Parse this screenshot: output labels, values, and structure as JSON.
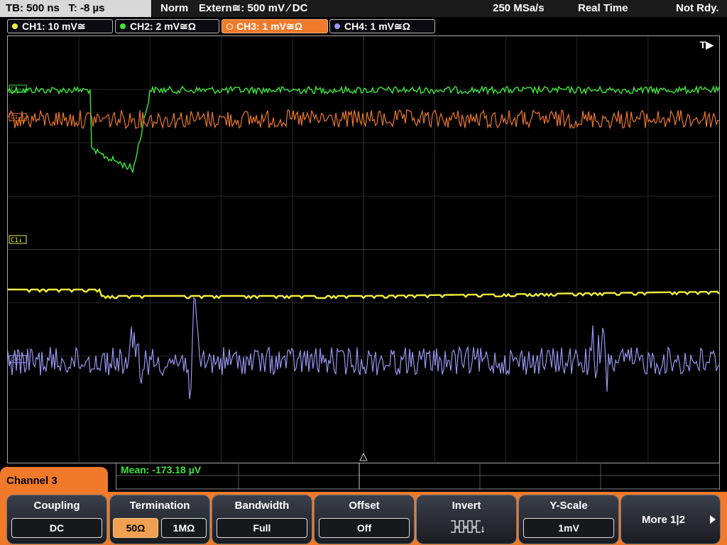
{
  "status": {
    "timebase": "TB: 500 ns",
    "trigger_time": "T: -8 µs",
    "mode": "Norm",
    "trigger_source": "Extern≅: 500 mV ⁄ DC",
    "sample_rate": "250 MSa/s",
    "acq_mode": "Real Time",
    "state": "Not Rdy."
  },
  "channels": [
    {
      "label": "CH1: 10 mV≅",
      "color": "#f2ee3a"
    },
    {
      "label": "CH2: 2 mV≅Ω",
      "color": "#3ee63e"
    },
    {
      "label": "CH3: 1 mV≅Ω",
      "color": "#f07a2a"
    },
    {
      "label": "CH4: 1 mV≅Ω",
      "color": "#9a96f2"
    }
  ],
  "plot": {
    "trigger_marker": "T▶",
    "ch1_marker": "C1↓",
    "ch2_marker": "C2→",
    "ch3_marker": "C3→",
    "ch4_marker": "C4→"
  },
  "measurement": {
    "text": "Mean: -173.18 µV"
  },
  "menu": {
    "channel_title": "Channel 3",
    "coupling": {
      "title": "Coupling",
      "value": "DC"
    },
    "termination": {
      "title": "Termination",
      "opt1": "50Ω",
      "opt2": "1MΩ"
    },
    "bandwidth": {
      "title": "Bandwidth",
      "value": "Full"
    },
    "offset": {
      "title": "Offset",
      "value": "Off"
    },
    "invert": {
      "title": "Invert",
      "icon": "invert-waveform-icon"
    },
    "yscale": {
      "title": "Y-Scale",
      "value": "1mV"
    },
    "more": {
      "label": "More 1|2"
    }
  }
}
